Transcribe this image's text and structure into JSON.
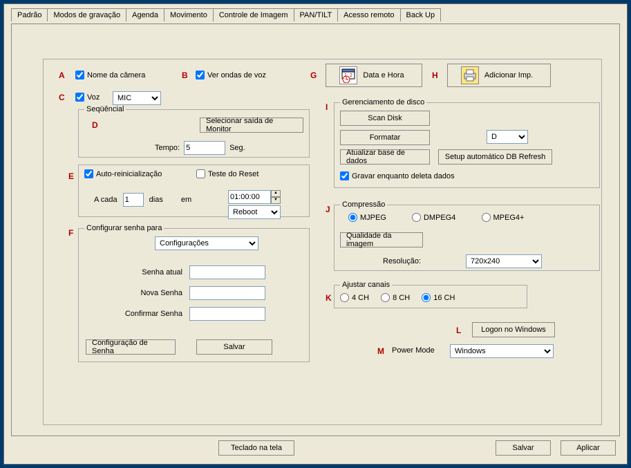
{
  "tabs": [
    "Padrão",
    "Modos de gravação",
    "Agenda",
    "Movimento",
    "Controle de Imagem",
    "PAN/TILT",
    "Acesso remoto",
    "Back Up"
  ],
  "markers": {
    "A": "A",
    "B": "B",
    "C": "C",
    "D": "D",
    "E": "E",
    "F": "F",
    "G": "G",
    "H": "H",
    "I": "I",
    "J": "J",
    "K": "K",
    "L": "L",
    "M": "M"
  },
  "camera_name_label": "Nome da câmera",
  "see_voice_waves_label": "Ver ondas de voz",
  "voice_label": "Voz",
  "voice_source": "MIC",
  "sequential": {
    "legend": "Seqüêncial",
    "select_monitor_btn": "Selecionar saída de Monitor",
    "time_label": "Tempo:",
    "time_value": "5",
    "seconds_label": "Seg."
  },
  "auto_reset": {
    "auto_label": "Auto-reinicialização",
    "test_label": "Teste do Reset",
    "every_label": "A cada",
    "days_value": "1",
    "days_label": "dias",
    "at_label": "em",
    "time_value": "01:00:00",
    "action_value": "Reboot"
  },
  "password": {
    "legend": "Configurar senha para",
    "target": "Configurações",
    "cur_label": "Senha atual",
    "new_label": "Nova Senha",
    "confirm_label": "Confirmar Senha",
    "config_btn": "Configuração de Senha",
    "save_btn": "Salvar"
  },
  "date_btn": "Data e Hora",
  "add_printer_btn": "Adicionar Imp.",
  "disk": {
    "legend": "Gerenciamento de disco",
    "scan_btn": "Scan Disk",
    "format_btn": "Formatar",
    "drive": "D",
    "update_db_btn": "Atualizar base de dados",
    "auto_db_btn": "Setup automático DB Refresh",
    "record_while_delete_label": "Gravar enquanto deleta dados"
  },
  "compression": {
    "legend": "Compressão",
    "mjpeg": "MJPEG",
    "dmpeg4": "DMPEG4",
    "mpeg4p": "MPEG4+",
    "quality_btn": "Qualidade da imagem",
    "resolution_label": "Resolução:",
    "resolution_value": "720x240"
  },
  "channels": {
    "legend": "Ajustar canais",
    "ch4": "4 CH",
    "ch8": "8 CH",
    "ch16": "16 CH"
  },
  "logon_btn": "Logon no Windows",
  "power_mode_label": "Power Mode",
  "power_mode_value": "Windows",
  "keyboard_btn": "Teclado na tela",
  "save_btn": "Salvar",
  "apply_btn": "Aplicar"
}
